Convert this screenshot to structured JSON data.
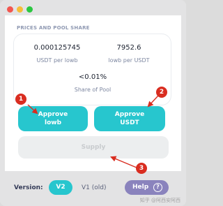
{
  "window": {
    "traffic_lights": [
      "close-icon",
      "minimize-icon",
      "zoom-icon"
    ]
  },
  "prices": {
    "section_title": "PRICES AND POOL SHARE",
    "price1_value": "0.000125745",
    "price1_label": "USDT per lowb",
    "price2_value": "7952.6",
    "price2_label": "lowb per USDT",
    "share_value": "<0.01%",
    "share_label": "Share of Pool"
  },
  "actions": {
    "approve_lowb": [
      "Approve",
      "lowb"
    ],
    "approve_usdt": [
      "Approve",
      "USDT"
    ],
    "supply": "Supply"
  },
  "annotations": {
    "badge1": "1",
    "badge2": "2",
    "badge3": "3",
    "color": "#d92d20"
  },
  "footer": {
    "version_label": "Version:",
    "v2": "V2",
    "v1": "V1 (old)",
    "help": "Help",
    "help_icon": "?"
  },
  "watermark": "知乎 @阿西安阿西",
  "colors": {
    "accent": "#27c6ce",
    "help": "#8a83bd",
    "supply_disabled": "#eceeef"
  }
}
